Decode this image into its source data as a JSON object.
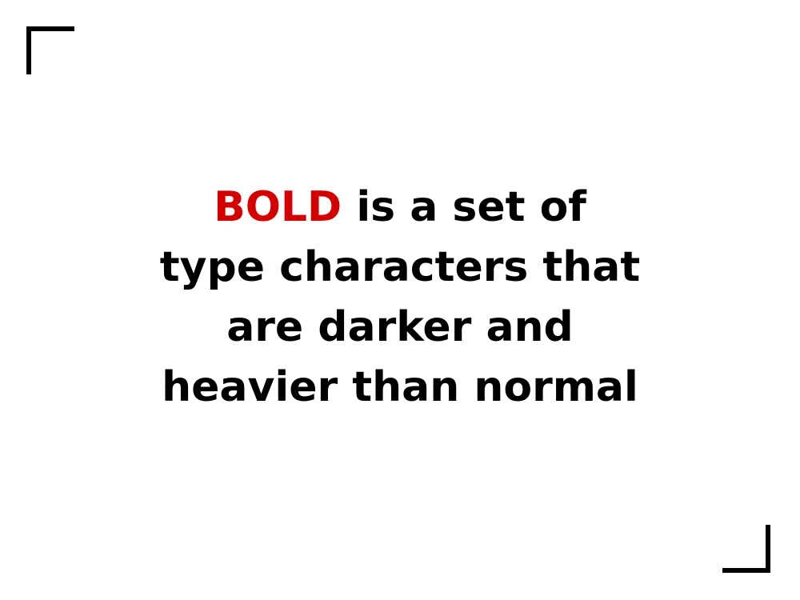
{
  "statement": {
    "highlight_word": "BOLD",
    "line1_rest": " is a set of",
    "line2": "type characters that",
    "line3": "are darker and",
    "line4": "heavier than normal"
  },
  "colors": {
    "highlight": "#d40000",
    "text": "#000000",
    "background": "#ffffff"
  }
}
